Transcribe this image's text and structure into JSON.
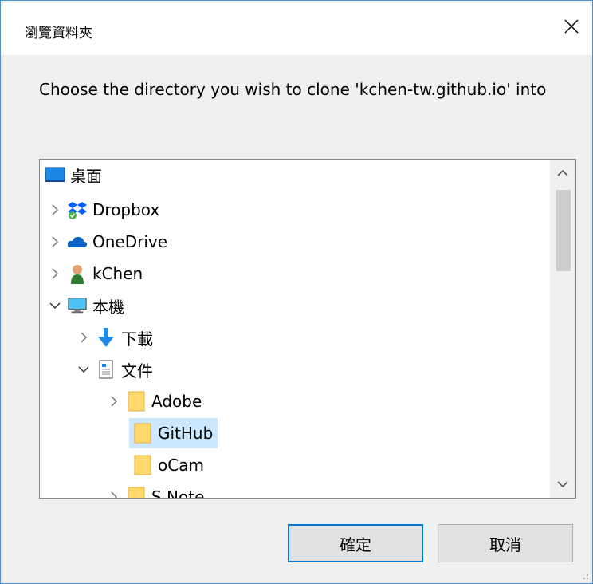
{
  "window": {
    "title": "瀏覽資料夾",
    "close_glyph": "✕"
  },
  "prompt": "Choose the directory you wish to clone 'kchen-tw.github.io' into",
  "tree": {
    "items": [
      {
        "label": "桌面",
        "icon": "desktop-icon",
        "expander": "none",
        "selected": false
      },
      {
        "label": "Dropbox",
        "icon": "dropbox-icon",
        "expander": "collapsed",
        "selected": false
      },
      {
        "label": "OneDrive",
        "icon": "onedrive-icon",
        "expander": "collapsed",
        "selected": false
      },
      {
        "label": "kChen",
        "icon": "user-icon",
        "expander": "collapsed",
        "selected": false
      },
      {
        "label": "本機",
        "icon": "computer-icon",
        "expander": "expanded",
        "selected": false
      },
      {
        "label": "下載",
        "icon": "download-icon",
        "expander": "collapsed",
        "selected": false
      },
      {
        "label": "文件",
        "icon": "documents-icon",
        "expander": "expanded",
        "selected": false
      },
      {
        "label": "Adobe",
        "icon": "folder-icon",
        "expander": "collapsed",
        "selected": false
      },
      {
        "label": "GitHub",
        "icon": "folder-icon",
        "expander": "none",
        "selected": true
      },
      {
        "label": "oCam",
        "icon": "folder-icon",
        "expander": "none",
        "selected": false
      },
      {
        "label": "S Note",
        "icon": "folder-icon",
        "expander": "collapsed",
        "selected": false
      }
    ]
  },
  "buttons": {
    "ok_label": "確定",
    "cancel_label": "取消"
  },
  "colors": {
    "accent": "#0078d7",
    "selection": "#cce8ff",
    "folder": "#ffd86b"
  }
}
